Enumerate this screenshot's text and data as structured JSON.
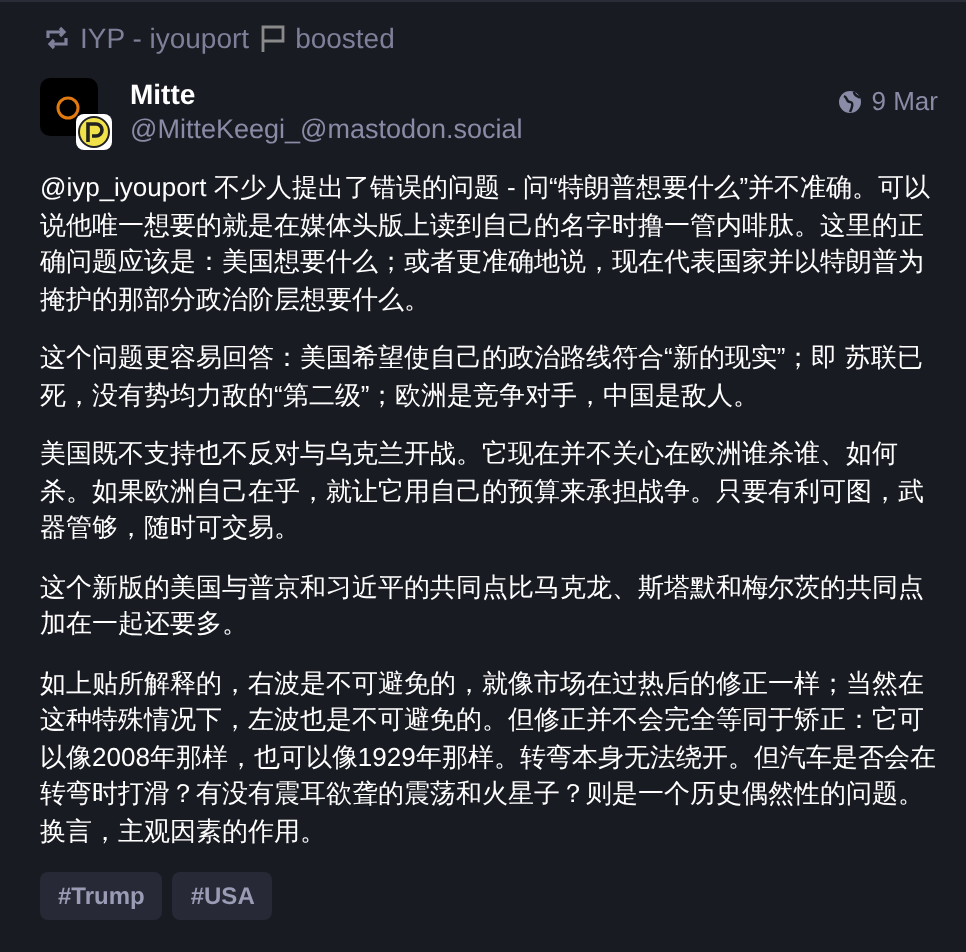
{
  "boost": {
    "account": "IYP - iyouport",
    "label": "boosted"
  },
  "author": {
    "name": "Mitte",
    "handle": "@MitteKeegi_@mastodon.social"
  },
  "date": "9 Mar",
  "paragraphs": [
    "@iyp_iyouport 不少人提出了错误的问题 - 问“特朗普想要什么”并不准确。可以说他唯一想要的就是在媒体头版上读到自己的名字时撸一管内啡肽。这里的正确问题应该是：美国想要什么；或者更准确地说，现在代表国家并以特朗普为掩护的那部分政治阶层想要什么。",
    "这个问题更容易回答：美国希望使自己的政治路线符合“新的现实”；即 苏联已死，没有势均力敌的“第二级”；欧洲是竞争对手，中国是敌人。",
    "美国既不支持也不反对与乌克兰开战。它现在并不关心在欧洲谁杀谁、如何杀。如果欧洲自己在乎，就让它用自己的预算来承担战争。只要有利可图，武器管够，随时可交易。",
    "这个新版的美国与普京和习近平的共同点比马克龙、斯塔默和梅尔茨的共同点加在一起还要多。",
    "如上贴所解释的，右波是不可避免的，就像市场在过热后的修正一样；当然在这种特殊情况下，左波也是不可避免的。但修正并不会完全等同于矫正：它可以像2008年那样，也可以像1929年那样。转弯本身无法绕开。但汽车是否会在转弯时打滑？有没有震耳欲聋的震荡和火星子？则是一个历史偶然性的问题。换言，主观因素的作用。"
  ],
  "tags": [
    "#Trump",
    "#USA"
  ]
}
